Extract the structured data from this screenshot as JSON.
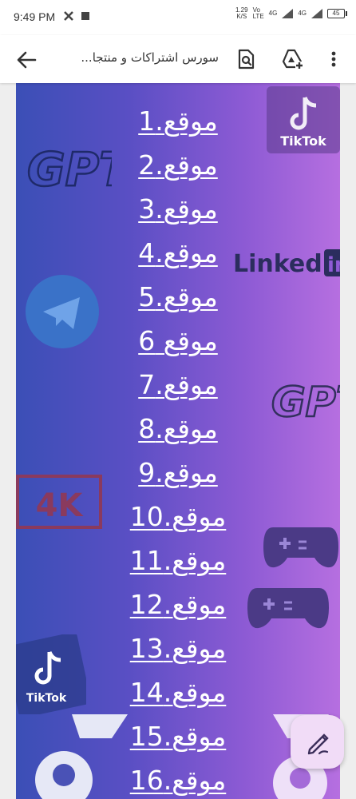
{
  "status_bar": {
    "time": "9:49 PM",
    "speed": "1.29",
    "speed_unit": "K/S",
    "net1": "Vo",
    "net1b": "LTE",
    "net2": "4G",
    "net3": "4G",
    "battery": "45"
  },
  "app_bar": {
    "title": "سورس اشتراكات و منتجا..."
  },
  "list_items": [
    "موقع.1",
    "موقع.2",
    "موقع.3",
    "موقع.4",
    "موقع.5",
    "موقع 6",
    "موقع.7",
    "موقع.8",
    "موقع.9",
    "موقع.10",
    "موقع.11",
    "موقع.12",
    "موقع.13",
    "موقع.14",
    "موقع.15",
    "موقع.16"
  ],
  "decorations": {
    "tiktok": "TikTok",
    "gpt": "GPT",
    "linkedin": "Linked",
    "linkedin_in": "in",
    "res": "4K"
  },
  "colors": {
    "gradient_left": "#3b4fb6",
    "gradient_right": "#b66fe0",
    "fab_bg": "#f1dcf7"
  }
}
